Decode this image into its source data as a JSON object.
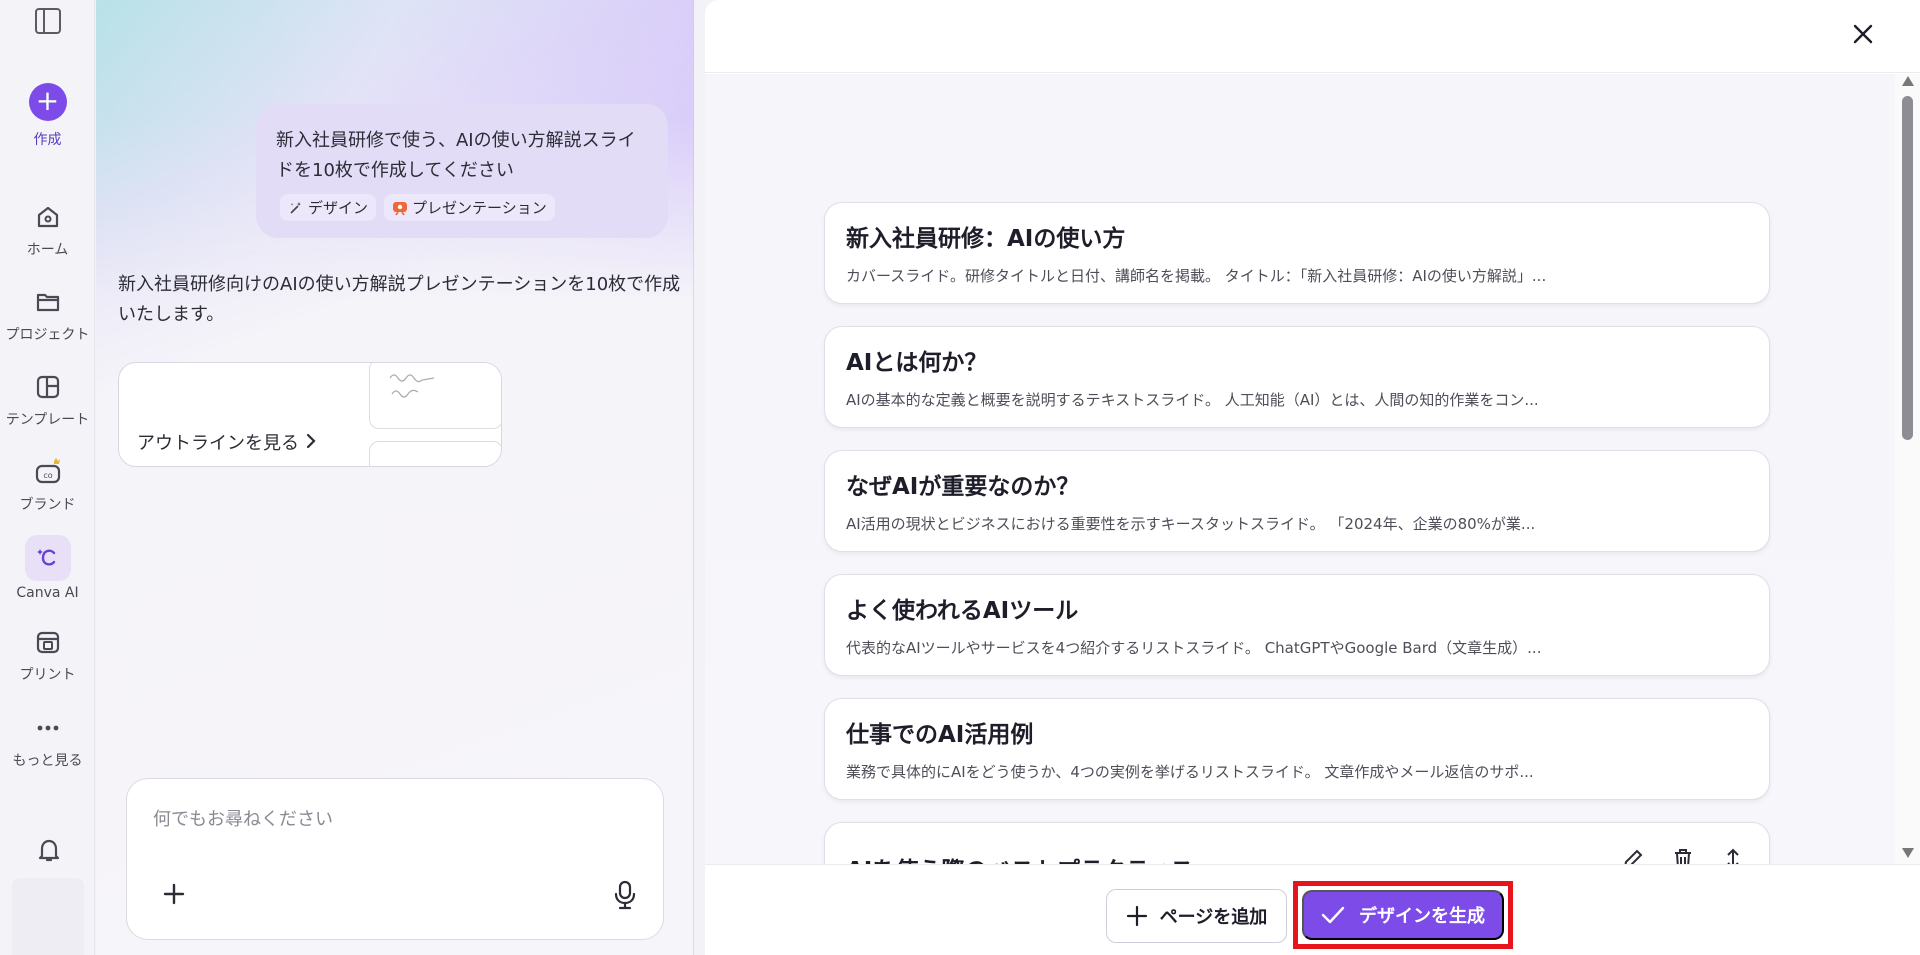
{
  "sidebar": {
    "create_label": "作成",
    "items": [
      {
        "label": "ホーム",
        "icon": "home-icon"
      },
      {
        "label": "プロジェクト",
        "icon": "folder-icon"
      },
      {
        "label": "テンプレート",
        "icon": "template-icon"
      },
      {
        "label": "ブランド",
        "icon": "brand-icon"
      },
      {
        "label": "Canva AI",
        "icon": "canva-ai-icon"
      },
      {
        "label": "プリント",
        "icon": "print-icon"
      },
      {
        "label": "もっと見る",
        "icon": "more-icon"
      }
    ]
  },
  "chat": {
    "user_message": "新入社員研修で使う、AIの使い方解説スライドを10枚で作成してください",
    "tags": [
      "デザイン",
      "プレゼンテーション"
    ],
    "reply": "新入社員研修向けのAIの使い方解説プレゼンテーションを10枚で作成いたします。",
    "outline_label": "アウトラインを見る",
    "input_placeholder": "何でもお尋ねください"
  },
  "slides": [
    {
      "title": "新入社員研修：AIの使い方",
      "desc": "カバースライド。研修タイトルと日付、講師名を掲載。 タイトル：「新入社員研修：AIの使い方解説」..."
    },
    {
      "title": "AIとは何か？",
      "desc": "AIの基本的な定義と概要を説明するテキストスライド。 人工知能（AI）とは、人間の知的作業をコン..."
    },
    {
      "title": "なぜAIが重要なのか？",
      "desc": "AI活用の現状とビジネスにおける重要性を示すキースタットスライド。 「2024年、企業の80%が業..."
    },
    {
      "title": "よく使われるAIツール",
      "desc": "代表的なAIツールやサービスを4つ紹介するリストスライド。 ChatGPTやGoogle Bard（文章生成）..."
    },
    {
      "title": "仕事でのAI活用例",
      "desc": "業務で具体的にAIをどう使うか、4つの実例を挙げるリストスライド。 文章作成やメール返信のサポ..."
    },
    {
      "title": "AIを使う際のベストプラクティス",
      "desc": ""
    }
  ],
  "footer": {
    "add_page_label": "ページを追加",
    "generate_label": "デザインを生成"
  },
  "colors": {
    "accent": "#7d4ce8",
    "highlight": "#e8141c"
  }
}
